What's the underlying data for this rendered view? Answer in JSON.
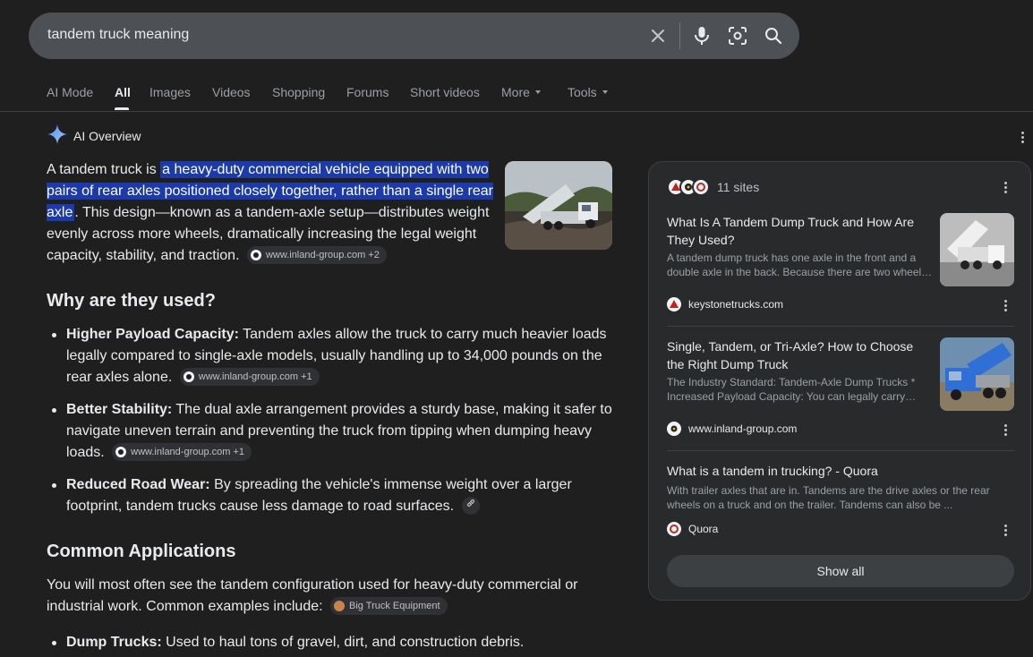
{
  "search": {
    "query": "tandem truck meaning",
    "icons": [
      "close-icon",
      "microphone-icon",
      "lens-icon",
      "search-icon"
    ]
  },
  "tabs": [
    {
      "label": "AI Mode"
    },
    {
      "label": "All",
      "active": true
    },
    {
      "label": "Images"
    },
    {
      "label": "Videos"
    },
    {
      "label": "Shopping"
    },
    {
      "label": "Forums"
    },
    {
      "label": "Short videos"
    },
    {
      "label": "More",
      "dropdown": true
    },
    {
      "label": "Tools",
      "dropdown": true
    }
  ],
  "ai_overview": {
    "label": "AI Overview",
    "intro": {
      "before": "A tandem truck is ",
      "highlight": "a heavy-duty commercial vehicle equipped with two pairs of rear axles positioned closely together, rather than a single rear axle",
      "after": ". This design—known as a tandem-axle setup—distributes weight evenly across more wheels, dramatically increasing the legal weight capacity, stability, and traction.",
      "chip": "www.inland-group.com +2"
    },
    "why_heading": "Why are they used?",
    "why_items": [
      {
        "term": "Higher Payload Capacity:",
        "text": " Tandem axles allow the truck to carry much heavier loads legally compared to single-axle models, usually handling up to 34,000 pounds on the rear axles alone.",
        "chip": "www.inland-group.com +1"
      },
      {
        "term": "Better Stability:",
        "text": " The dual axle arrangement provides a sturdy base, making it safer to navigate uneven terrain and preventing the truck from tipping when dumping heavy loads.",
        "chip": "www.inland-group.com +1"
      },
      {
        "term": "Reduced Road Wear:",
        "text": " By spreading the vehicle's immense weight over a larger footprint, tandem trucks cause less damage to road surfaces.",
        "chip": ""
      }
    ],
    "common_heading": "Common Applications",
    "common_text": "You will most often see the tandem configuration used for heavy-duty commercial or industrial work. Common examples include:",
    "common_chip": "Big Truck Equipment",
    "common_items": [
      {
        "term": "Dump Trucks:",
        "text": " Used to haul tons of gravel, dirt, and construction debris."
      }
    ]
  },
  "panel": {
    "sites_label": "11 sites",
    "sources": [
      {
        "title": "What Is A Tandem Dump Truck and How Are They Used?",
        "snippet": "A tandem dump truck has one axle in the front and a double axle in the back. Because there are two wheel…",
        "site": "keystonetrucks.com"
      },
      {
        "title": "Single, Tandem, or Tri-Axle? How to Choose the Right Dump Truck",
        "snippet": "The Industry Standard: Tandem-Axle Dump Trucks * Increased Payload Capacity: You can legally carry…",
        "site": "www.inland-group.com"
      },
      {
        "title": "What is a tandem in trucking? - Quora",
        "snippet": "With trailer axles that are in. Tandems are the drive axles or the rear wheels on a truck and on the trailer. Tandems can also be ...",
        "site": "Quora"
      }
    ],
    "show_all": "Show all"
  },
  "colors": {
    "background": "#1f1f1f",
    "search_bar": "#4d5156",
    "highlight": "#1c3aa9",
    "panel": "#282a2c"
  }
}
